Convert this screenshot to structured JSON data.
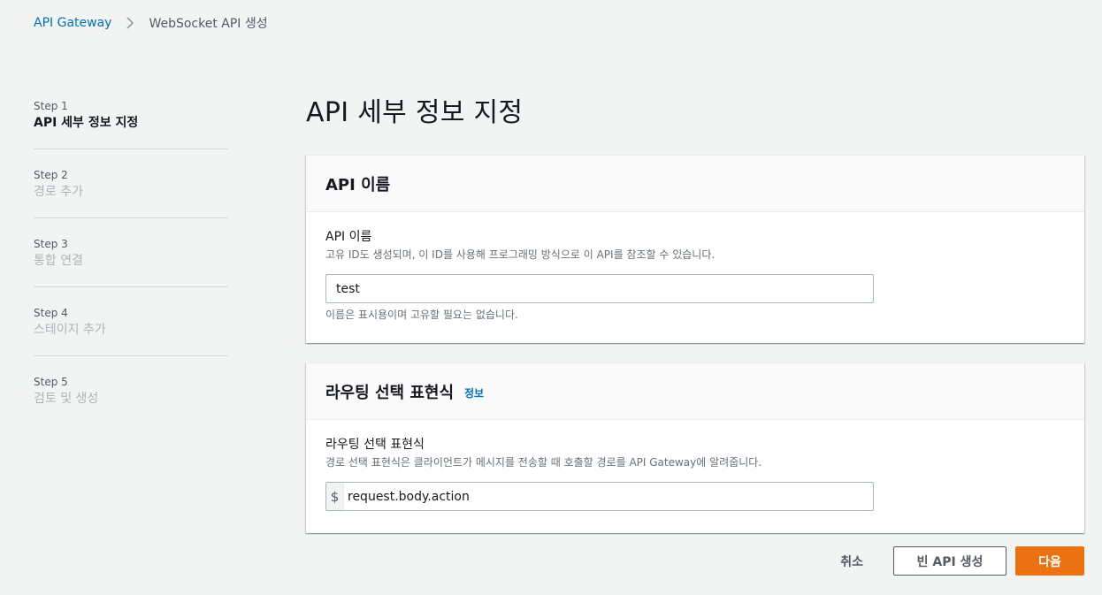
{
  "breadcrumb": {
    "root": "API Gateway",
    "current": "WebSocket API 생성"
  },
  "steps": [
    {
      "num": "Step 1",
      "title": "API 세부 정보 지정"
    },
    {
      "num": "Step 2",
      "title": "경로 추가"
    },
    {
      "num": "Step 3",
      "title": "통합 연결"
    },
    {
      "num": "Step 4",
      "title": "스테이지 추가"
    },
    {
      "num": "Step 5",
      "title": "검토 및 생성"
    }
  ],
  "page_title": "API 세부 정보 지정",
  "api_name_panel": {
    "header": "API 이름",
    "label": "API 이름",
    "description": "고유 ID도 생성되며, 이 ID를 사용해 프로그래밍 방식으로 이 API를 참조할 수 있습니다.",
    "value": "test",
    "constraint": "이름은 표시용이며 고유할 필요는 없습니다."
  },
  "route_panel": {
    "header": "라우팅 선택 표현식",
    "info": "정보",
    "label": "라우팅 선택 표현식",
    "description": "경로 선택 표현식은 클라이언트가 메시지를 전송할 때 호출할 경로를 API Gateway에 알려줍니다.",
    "prefix": "$",
    "value": "request.body.action"
  },
  "footer": {
    "cancel": "취소",
    "create_empty": "빈 API 생성",
    "next": "다음"
  },
  "colors": {
    "link": "#0073bb",
    "primary": "#ec7211",
    "background": "#f2f3f3"
  }
}
